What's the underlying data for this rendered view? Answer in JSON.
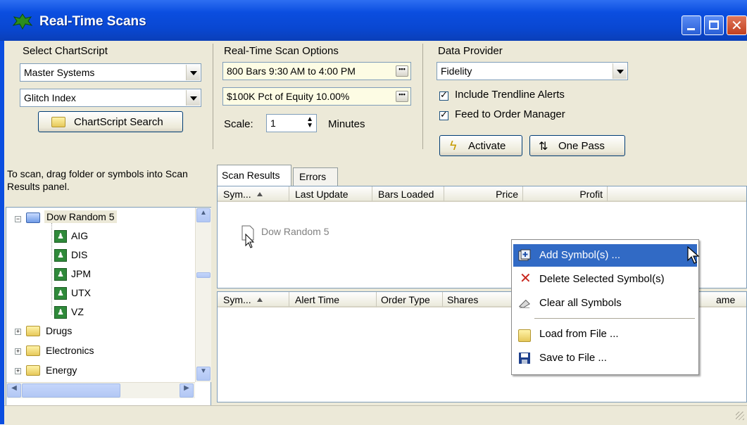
{
  "window": {
    "title": "Real-Time Scans"
  },
  "chartscript": {
    "section_label": "Select ChartScript",
    "combo1": "Master Systems",
    "combo2": "Glitch Index",
    "search_button": "ChartScript Search"
  },
  "scan_options": {
    "section_label": "Real-Time Scan Options",
    "bars_field": "800 Bars 9:30 AM to 4:00 PM",
    "equity_field": "$100K Pct of Equity 10.00%",
    "scale_label": "Scale:",
    "scale_value": "1",
    "minutes_label": "Minutes"
  },
  "data_provider": {
    "section_label": "Data Provider",
    "combo": "Fidelity",
    "include_trendline": "Include Trendline Alerts",
    "feed_order": "Feed to Order Manager",
    "activate_button": "Activate",
    "one_pass_button": "One Pass"
  },
  "left_panel": {
    "instruction": "To scan, drag folder or symbols into Scan Results panel.",
    "tree": {
      "open_folder": "Dow Random 5",
      "symbols": [
        "AIG",
        "DIS",
        "JPM",
        "UTX",
        "VZ"
      ],
      "folders": [
        "Drugs",
        "Electronics",
        "Energy"
      ]
    }
  },
  "tabs": {
    "scan_results": "Scan Results",
    "errors": "Errors"
  },
  "scan_results": {
    "columns": [
      "Sym...",
      "Last Update",
      "Bars Loaded",
      "Price",
      "Profit"
    ],
    "drag_text": "Dow Random 5"
  },
  "alerts": {
    "columns": [
      "Sym...",
      "Alert Time",
      "Order Type",
      "Shares",
      "ame"
    ]
  },
  "context_menu": {
    "items": [
      "Add Symbol(s) ...",
      "Delete Selected Symbol(s)",
      "Clear all Symbols",
      "Load from File ...",
      "Save to File ..."
    ]
  },
  "colors": {
    "title_bar": "#0b4ee0",
    "menu_highlight": "#316ac5",
    "window_bg": "#ece9d8"
  }
}
